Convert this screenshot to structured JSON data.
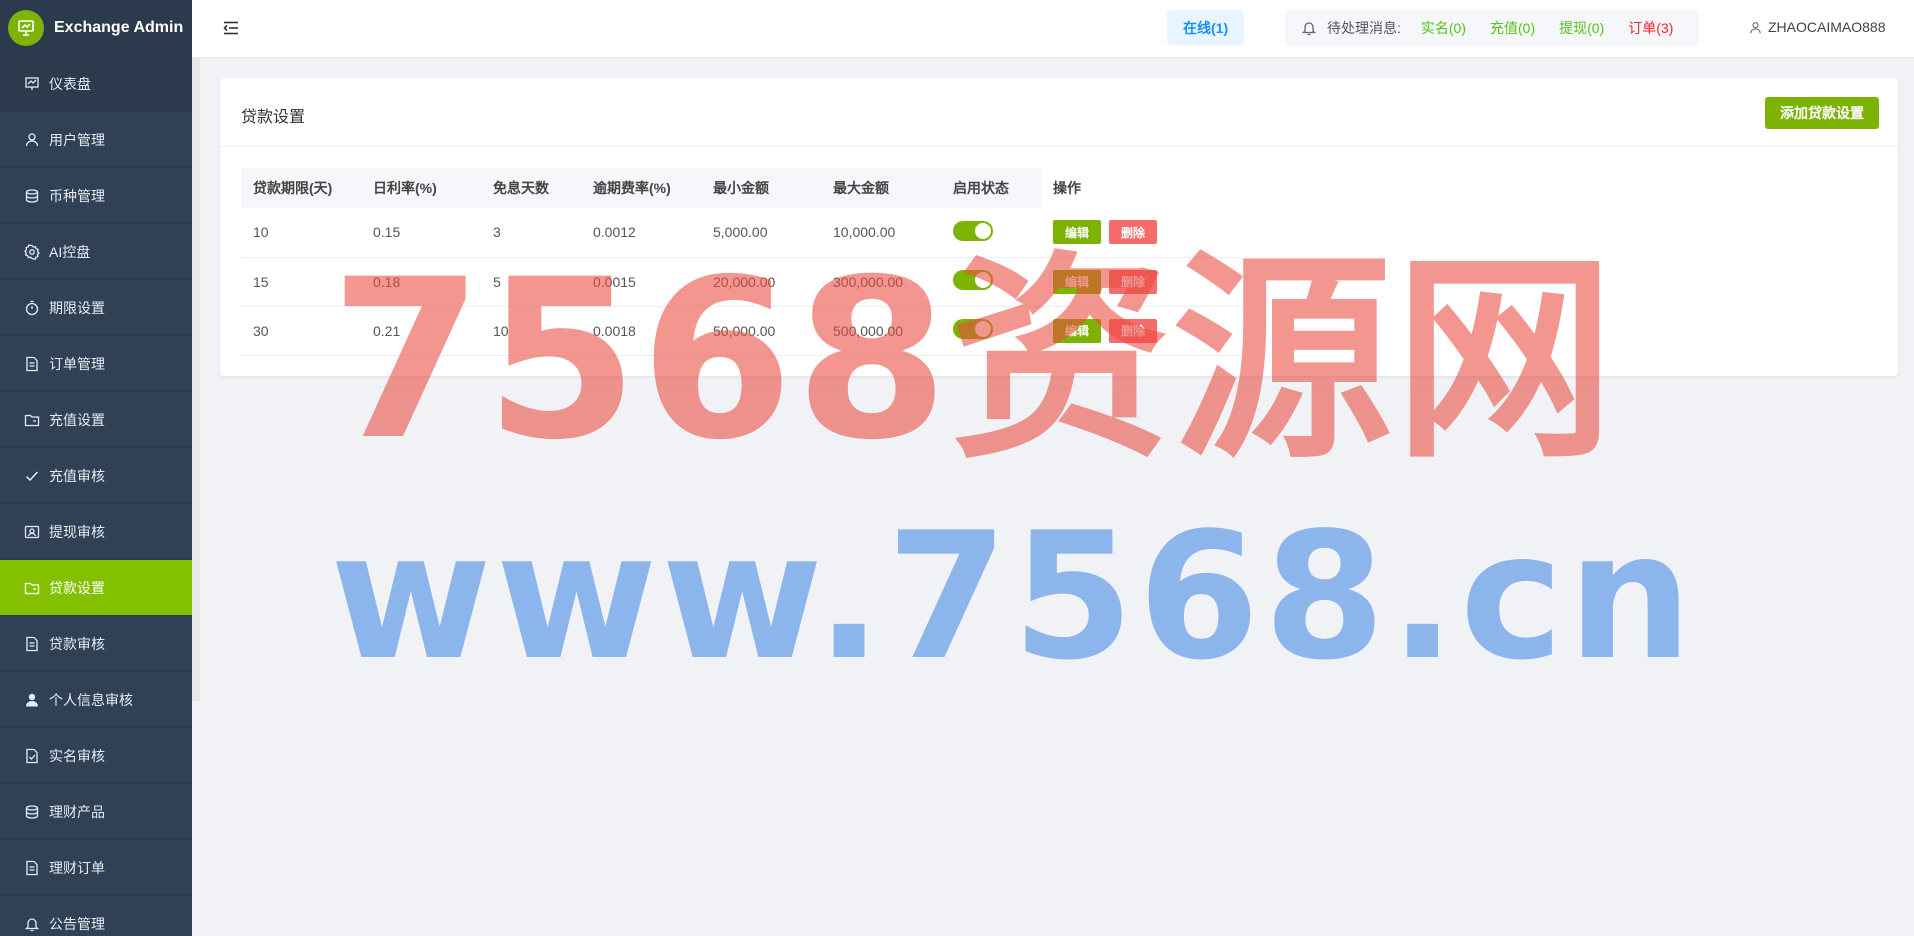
{
  "brand": {
    "title": "Exchange Admin"
  },
  "sidebar": {
    "items": [
      {
        "label": "仪表盘",
        "icon": "dashboard-icon"
      },
      {
        "label": "用户管理",
        "icon": "user-icon"
      },
      {
        "label": "币种管理",
        "icon": "database-icon"
      },
      {
        "label": "AI控盘",
        "icon": "gear-icon"
      },
      {
        "label": "期限设置",
        "icon": "timer-icon"
      },
      {
        "label": "订单管理",
        "icon": "document-icon"
      },
      {
        "label": "充值设置",
        "icon": "folder-icon"
      },
      {
        "label": "充值审核",
        "icon": "check-icon"
      },
      {
        "label": "提现审核",
        "icon": "id-card-icon"
      },
      {
        "label": "贷款设置",
        "icon": "folder-icon",
        "active": true
      },
      {
        "label": "贷款审核",
        "icon": "document-icon"
      },
      {
        "label": "个人信息审核",
        "icon": "person-icon"
      },
      {
        "label": "实名审核",
        "icon": "document-check-icon"
      },
      {
        "label": "理财产品",
        "icon": "database-icon"
      },
      {
        "label": "理财订单",
        "icon": "document-icon"
      },
      {
        "label": "公告管理",
        "icon": "bell-icon"
      }
    ]
  },
  "header": {
    "online": "在线(1)",
    "pending_label": "待处理消息:",
    "pending": [
      {
        "label": "实名(0)",
        "color": "green"
      },
      {
        "label": "充值(0)",
        "color": "green"
      },
      {
        "label": "提现(0)",
        "color": "green"
      },
      {
        "label": "订单(3)",
        "color": "red"
      }
    ],
    "username": "ZHAOCAIMAO888"
  },
  "card": {
    "title": "贷款设置",
    "add_button": "添加贷款设置"
  },
  "table": {
    "columns": [
      "贷款期限(天)",
      "日利率(%)",
      "免息天数",
      "逾期费率(%)",
      "最小金额",
      "最大金额",
      "启用状态",
      "操作"
    ],
    "rows": [
      {
        "term": "10",
        "rate": "0.15",
        "free_days": "3",
        "overdue_rate": "0.0012",
        "min": "5,000.00",
        "max": "10,000.00",
        "enabled": true
      },
      {
        "term": "15",
        "rate": "0.18",
        "free_days": "5",
        "overdue_rate": "0.0015",
        "min": "20,000.00",
        "max": "300,000.00",
        "enabled": true
      },
      {
        "term": "30",
        "rate": "0.21",
        "free_days": "10",
        "overdue_rate": "0.0018",
        "min": "50,000.00",
        "max": "500,000.00",
        "enabled": true
      }
    ],
    "edit_label": "编辑",
    "delete_label": "删除"
  },
  "watermark": {
    "line1": "7568资源网",
    "line2": "www.7568.cn"
  },
  "colors": {
    "accent": "#7cb305",
    "sidebar_bg": "#304156",
    "danger": "#f56c6c",
    "link_blue": "#1890ff"
  }
}
